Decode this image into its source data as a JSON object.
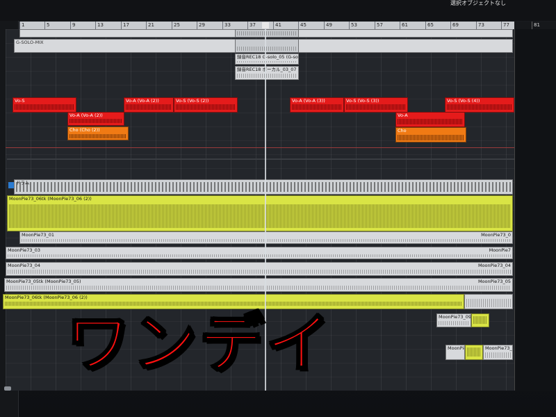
{
  "status_text": "選択オブジェクトなし",
  "ruler": {
    "ticks": [
      {
        "label": "1"
      },
      {
        "label": "5"
      },
      {
        "label": "9"
      },
      {
        "label": "13"
      },
      {
        "label": "17"
      },
      {
        "label": "21"
      },
      {
        "label": "25"
      },
      {
        "label": "29"
      },
      {
        "label": "33"
      },
      {
        "label": "37"
      },
      {
        "label": "41"
      },
      {
        "label": "45"
      },
      {
        "label": "49"
      },
      {
        "label": "53"
      },
      {
        "label": "57"
      },
      {
        "label": "61"
      },
      {
        "label": "65"
      },
      {
        "label": "69"
      },
      {
        "label": "73"
      },
      {
        "label": "77"
      },
      {
        "label": "81"
      }
    ]
  },
  "clips": {
    "top_bar": "",
    "gsolo_mix": "G-SOLO-MIX",
    "gsolo_a": "",
    "gsolo_b": "録音REC18 G-solo_05 (G-solo)",
    "gsolo_c": "録音REC18 ボーカル_03_07 (ボーカル)",
    "vos_1": "Vo-S",
    "voa_2": "Vo-A (Vo-A (2))",
    "cho_1": "Cho (Cho (2))",
    "voa_3": "Vo-A (Vo-A (2))",
    "vos_4": "Vo-S (Vo-S (2))",
    "voa_5": "Vo-A (Vo-A (3))",
    "vos_6": "Vo-S (Vo-S (3))",
    "voa_7": "Vo-A",
    "cho_2": "Cho",
    "vos_8": "Vo-S (Vo-S (4))",
    "midi_label": "ドラム",
    "yellow_main": "MoonPie73_06tk (MoonPie73_06 (2))",
    "gray_01": "MoonPie73_01",
    "gray_01_r": "MoonPie73_0",
    "gray_03": "MoonPie73_03",
    "gray_03_r": "MoonPie7",
    "gray_04": "MoonPie73_04",
    "gray_04_r": "MoonPie73_04",
    "gray_05": "MoonPie73_05tk (MoonPie73_05)",
    "gray_05_r": "MoonPie73_05",
    "yellow_06": "MoonPie73_06tk (MoonPie73_06 (2))",
    "small_09": "MoonPie73_09",
    "small_moon": "MoonPie73",
    "small_11": "MoonPie73_11"
  },
  "overlay": {
    "text": "ワンデイ"
  },
  "colors": {
    "vocal_red": "#e51b1b",
    "chorus_orange": "#f07a14",
    "piano_yellow": "#d9e445",
    "clip_gray": "#d7d9dc"
  }
}
